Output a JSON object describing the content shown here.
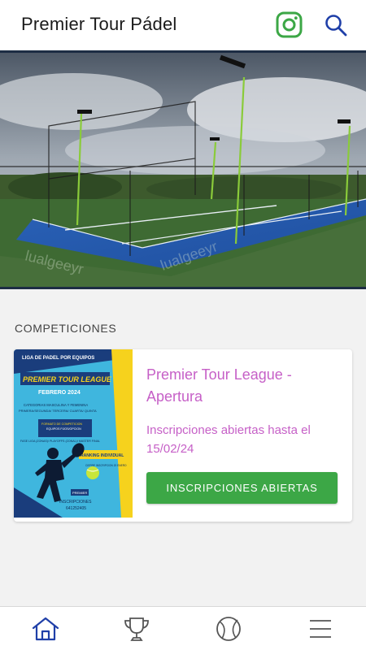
{
  "app": {
    "title": "Premier Tour Pádel"
  },
  "colors": {
    "accent": "#c660c7",
    "primary_button": "#3ca746",
    "nav_active": "#1f3fa8",
    "instagram": "#3ca746",
    "search": "#1f3fa8"
  },
  "header": {
    "icons": [
      "instagram-icon",
      "search-icon"
    ]
  },
  "section": {
    "title": "COMPETICIONES"
  },
  "competition": {
    "title": "Premier Tour League - Apertura",
    "subtitle": "Inscripciones abiertas hasta el 15/02/24",
    "button_label": "INSCRIPCIONES ABIERTAS",
    "poster": {
      "header": "LIGA DE PADEL POR EQUIPOS",
      "banner": "PREMIER TOUR LEAGUE",
      "month": "FEBRERO 2024",
      "categories_line1": "CATEGORIAS MASCULINA Y FEMENINA",
      "categories_line2": "PRIMERA/SEGUNDA/ TERCERA/ CUARTA/ QUINTA",
      "format_line1": "FORMATO DE COMPETICION",
      "format_line2": "EQUIPOS FIJOS/OPCION",
      "format_line3": "FASE LIGA (ZONAS)/ PLAYOFFS (ZONAL)/ MASTER FINAL",
      "ranking": "RANKING INDIVIDUAL",
      "closing": "CIERRE INSCRIPCION 20 ENERO",
      "inscriptions": "INSCRIPCIONES",
      "phone": "641252405",
      "badge": "PREMIER"
    }
  },
  "bottom_nav": {
    "items": [
      {
        "icon": "home-icon",
        "active": true
      },
      {
        "icon": "trophy-icon",
        "active": false
      },
      {
        "icon": "ball-icon",
        "active": false
      },
      {
        "icon": "menu-icon",
        "active": false
      }
    ]
  }
}
